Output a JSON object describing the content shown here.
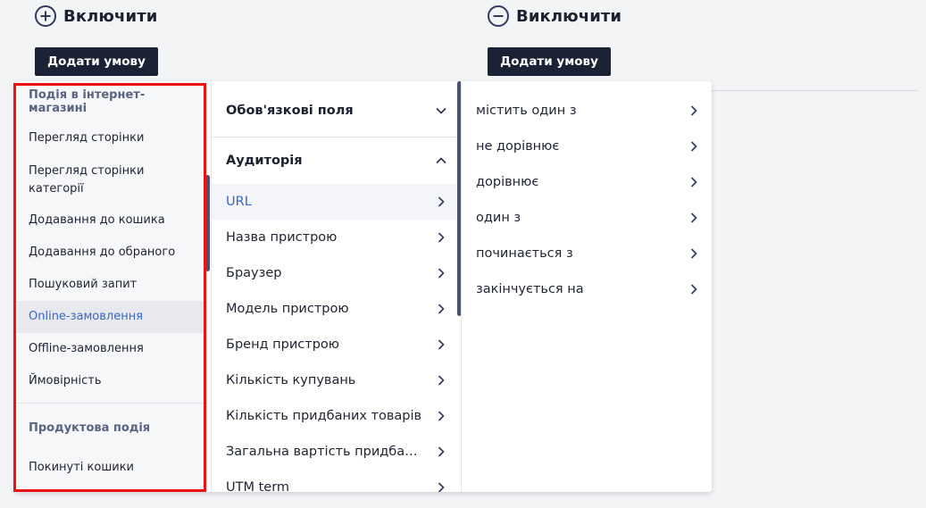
{
  "include": {
    "title": "Включити",
    "add_label": "Додати умову"
  },
  "exclude": {
    "title": "Виключити",
    "add_label": "Додати умову"
  },
  "col1": {
    "group1_title": "Подія в інтернет-магазині",
    "group1_items": [
      "Перегляд сторінки",
      "Перегляд сторінки категорії",
      "Додавання до кошика",
      "Додавання до обраного",
      "Пошуковий запит",
      "Online-замовлення",
      "Offline-замовлення",
      "Ймовірність"
    ],
    "selected_item": "Online-замовлення",
    "group2_title": "Продуктова подія",
    "group2_items": [
      "Покинуті кошики"
    ]
  },
  "col2": {
    "required_fields": "Обов'язкові поля",
    "audience": "Аудиторія",
    "items": [
      "URL",
      "Назва пристрою",
      "Браузер",
      "Модель пристрою",
      "Бренд пристрою",
      "Кількість купувань",
      "Кількість придбаних товарів",
      "Загальна вартість придбаних товарів",
      "UTM term"
    ],
    "selected_item": "URL"
  },
  "col3": {
    "items": [
      "містить один з",
      "не дорівнює",
      "дорівнює",
      "один з",
      "починається з",
      "закінчується на"
    ]
  },
  "colors": {
    "accent": "#3a66c4",
    "button_bg": "#1c2236",
    "highlight": "#ee1111"
  }
}
